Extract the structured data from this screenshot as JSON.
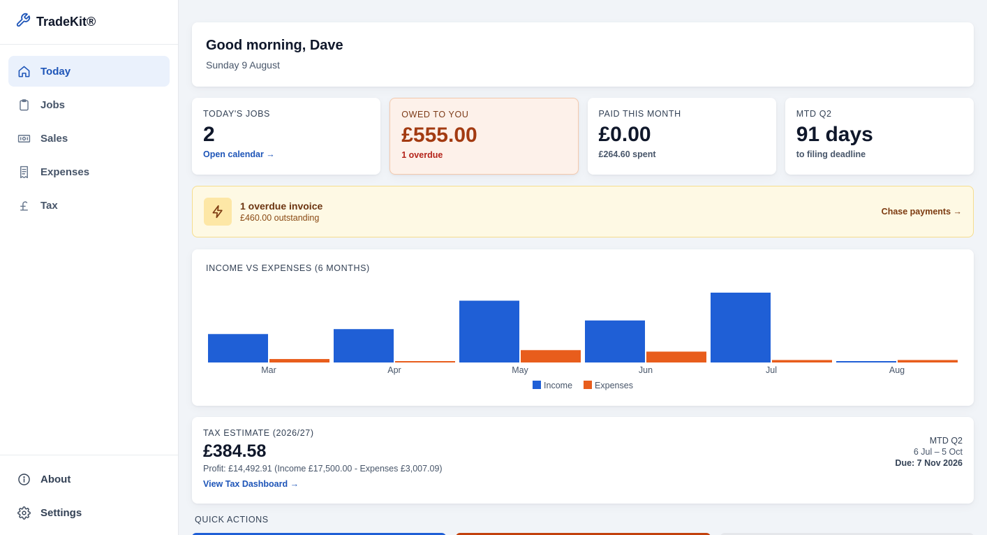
{
  "app": {
    "name": "TradeKit®"
  },
  "colors": {
    "accent": "#1e55b8",
    "income": "#1f5fd6",
    "expenses": "#e85d1c"
  },
  "sidebar": {
    "items": [
      {
        "label": "Today",
        "icon": "home-icon"
      },
      {
        "label": "Jobs",
        "icon": "clipboard-icon"
      },
      {
        "label": "Sales",
        "icon": "banknote-icon"
      },
      {
        "label": "Expenses",
        "icon": "receipt-icon"
      },
      {
        "label": "Tax",
        "icon": "pound-icon"
      }
    ],
    "bottom": [
      {
        "label": "About",
        "icon": "info-icon"
      },
      {
        "label": "Settings",
        "icon": "gear-icon"
      }
    ]
  },
  "greeting": {
    "title": "Good morning, Dave",
    "date": "Sunday 9 August"
  },
  "stats": [
    {
      "label": "TODAY'S JOBS",
      "value": "2",
      "sub": "Open calendar →"
    },
    {
      "label": "OWED TO YOU",
      "value": "£555.00",
      "sub": "1 overdue"
    },
    {
      "label": "PAID THIS MONTH",
      "value": "£0.00",
      "sub": "£264.60 spent"
    },
    {
      "label": "MTD Q2",
      "value": "91 days",
      "sub": "to filing deadline"
    }
  ],
  "alert": {
    "title": "1 overdue invoice",
    "subtitle": "£460.00 outstanding",
    "cta": "Chase payments →"
  },
  "chart_data": {
    "type": "bar",
    "title": "INCOME VS EXPENSES (6 MONTHS)",
    "categories": [
      "Mar",
      "Apr",
      "May",
      "Jun",
      "Jul",
      "Aug"
    ],
    "series": [
      {
        "name": "Income",
        "values": [
          2300,
          2700,
          5000,
          3400,
          5650,
          100
        ]
      },
      {
        "name": "Expenses",
        "values": [
          280,
          100,
          1000,
          880,
          200,
          200
        ]
      }
    ],
    "ylim": [
      0,
      5650
    ],
    "legend": "bottom",
    "grid": false
  },
  "tax": {
    "label": "TAX ESTIMATE (2026/27)",
    "value": "£384.58",
    "profit": "Profit: £14,492.91 (Income £17,500.00 - Expenses £3,007.09)",
    "link": "View Tax Dashboard →",
    "period_label": "MTD Q2",
    "period_range": "6 Jul – 5 Oct",
    "due": "Due: 7 Nov 2026"
  },
  "quick_actions": {
    "title": "QUICK ACTIONS"
  }
}
